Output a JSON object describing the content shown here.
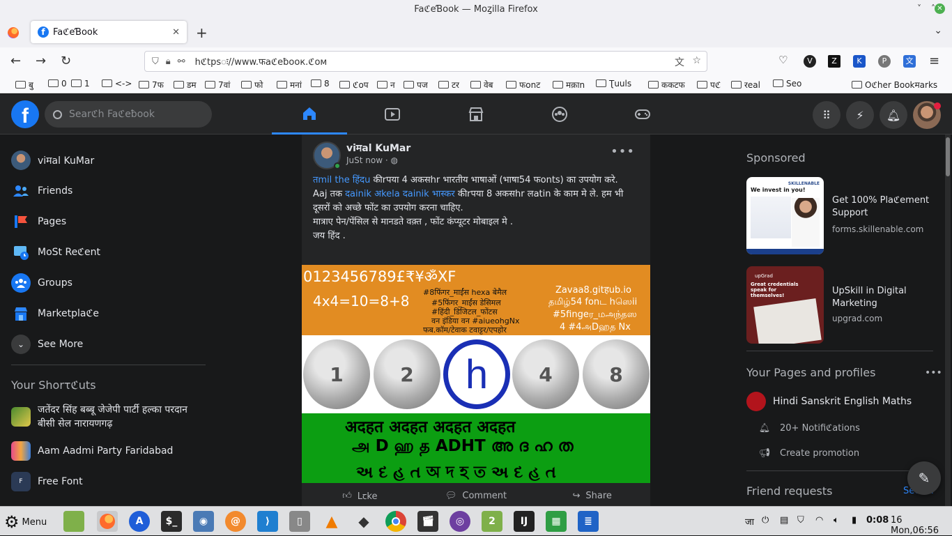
{
  "window": {
    "title": "FaℭeƁook — Moȥilla Firefox"
  },
  "tab": {
    "title": "FaℭeƁook",
    "favicon_letter": "f",
    "close": "✕"
  },
  "browser": {
    "url": "https://www.facebook.com",
    "url_display": "hℭtpsः//www.फaℭeƀooк.ℭoм",
    "newtab": "+",
    "tablist": "⌄"
  },
  "bookmarks": {
    "items": [
      "बु",
      "0",
      "1",
      "<->",
      "7फ",
      "डम",
      "7वां",
      "फो",
      "मनां",
      "8",
      "ℭoप",
      "न",
      "पज",
      "टर",
      "वेब",
      "फonट",
      "मक़ाn",
      "Ʈuuls",
      "ककटफ",
      "पℭ",
      "रeal",
      "Seo"
    ],
    "other": "Oℭher Bookमarks"
  },
  "fb": {
    "logo": "f",
    "search_placeholder": "Searℭh Faℭeƀook",
    "avatar_dot": true
  },
  "left": {
    "profile_name": "viमal KuMar",
    "items": [
      {
        "label": "Friends",
        "icon": "friends-icon"
      },
      {
        "label": "Pages",
        "icon": "pages-icon"
      },
      {
        "label": "MoSt Reℭent",
        "icon": "recent-icon"
      },
      {
        "label": "Groups",
        "icon": "groups-icon"
      },
      {
        "label": "Marketplaℭe",
        "icon": "marketplace-icon"
      },
      {
        "label": "See More",
        "icon": "chevron-down-icon"
      }
    ],
    "shortcuts_heading": "Your Shorτℭuts",
    "shortcuts": [
      {
        "line1": "जतेंदर सिंह बब्बू जेजेपी पार्टी हल्का परदान",
        "line2": "बीसी सेल नारायणगढ़"
      },
      {
        "line1": "Aam Aadmi Party Faridabad",
        "line2": ""
      },
      {
        "line1": "Free Font",
        "line2": ""
      }
    ]
  },
  "post": {
    "author": "viमal KuMar",
    "time": "JuSt now ·",
    "more": "•••",
    "text_link1": "तmil the हिंदu",
    "text1": " कीrपया 4 अकसhr भारतीय भाषाओं (भाषा54 फonts) का उपयोग करे.",
    "text2_pre": "Aaj तक ",
    "text_link2": "दainik अkela दainik भास्कर",
    "text2": " कीrपया 8 अकसhr लatin के काम मे ले. हम भी दूसरों को अच्छे फोंट का उपयोग करना चाहिए.",
    "text3": "मात्राए पेन/पेंसिल से मानडते वक़्त , फोंट कंप्यूटर मोबाइल मे .",
    "text4": "जय हिंद .",
    "image": {
      "line1": "0123456789£₹¥ॐXF",
      "line2": "4x4=10=8+8",
      "line3": "#8फिंगर_माईंस hexa बेमैल",
      "line4": "#5फिंगर_माईंस डेसिमल",
      "line5": "#हिंदी_डिजिटल_फोंटस",
      "line6": "वन इंडिया वन #aiueohgNx",
      "line7": "फब.कॉम/टेवाक टवाट्टर/एपहोर",
      "right1": "Zavaa8.gitहub.io",
      "right2": "தமிழ்54 fonட hஸெii",
      "right3": "#5fingeர_மஅந்தஸ",
      "right4": "4 #4அDஹத Nx",
      "coins": [
        "1",
        "2",
        "h",
        "4",
        "8"
      ],
      "green1": "अदहत अदहत अदहत अदहत",
      "green2": "அ D ஹ த  ADHT  അ ദ ഹ ത",
      "green3": "અ દ હ ત  অ দ হ ত  અ દ હ ત"
    },
    "actions": {
      "like": "Lꞇke",
      "comment": "Comment",
      "share": "Share"
    }
  },
  "right": {
    "sponsored": "Sponsored",
    "ads": [
      {
        "title": "Get 100% Plaℭement Support",
        "url": "forms.skillenable.com",
        "img_heading": "We invest in you!",
        "img_brand": "SKILLENABLE"
      },
      {
        "title": "UpSkill in Digital Marketing",
        "url": "upgrad.com",
        "img_heading": "Great credentials speak for themselves!",
        "img_brand": "upGrad"
      }
    ],
    "pages_heading": "Your Pages and profiles",
    "page_name": "Hindi Sanskrit English Maths",
    "notifications": "20+ Notifiℭations",
    "create_promotion": "Create promotion",
    "friend_requests": "Friend requests",
    "see_all": "See all"
  },
  "taskbar": {
    "menu": "Menu",
    "lang": "जा",
    "time": "0:08",
    "date": "16 Mon,06:56"
  }
}
